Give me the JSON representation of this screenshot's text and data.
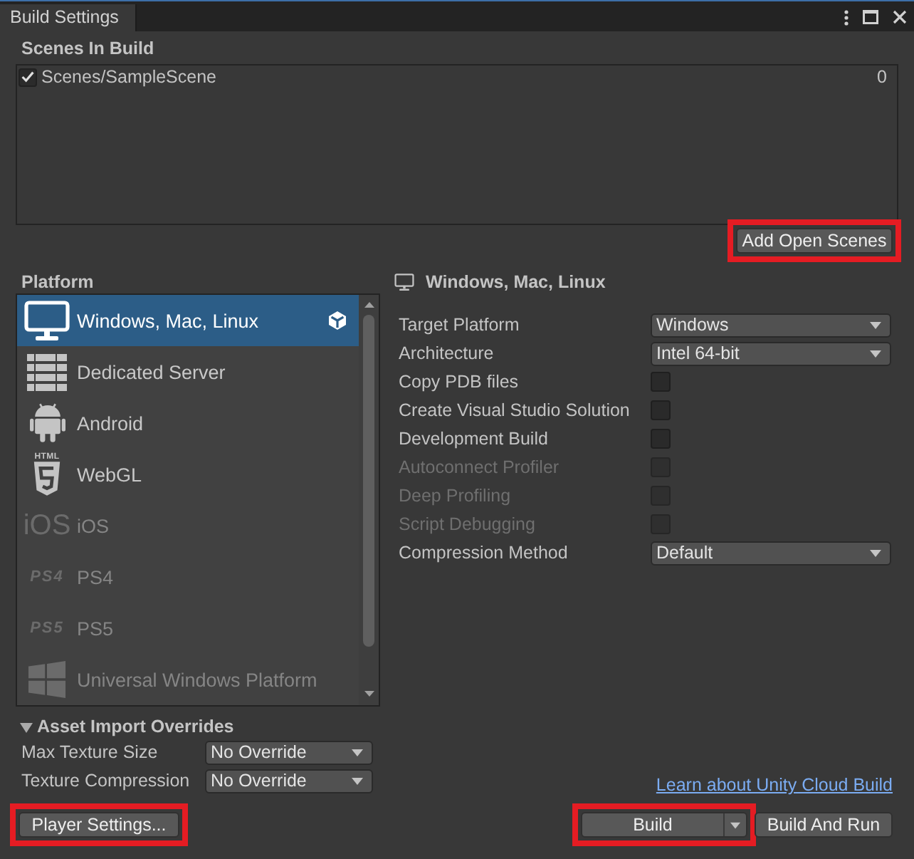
{
  "window": {
    "title": "Build Settings"
  },
  "scenes_in_build": {
    "title": "Scenes In Build",
    "scenes": [
      {
        "name": "Scenes/SampleScene",
        "checked": true,
        "index": "0"
      }
    ],
    "add_open_scenes_button": {
      "label": "Add Open Scenes",
      "highlighted": true
    }
  },
  "platform": {
    "title": "Platform",
    "items": [
      {
        "label": "Windows, Mac, Linux",
        "selected": true,
        "active": true,
        "disabled": false
      },
      {
        "label": "Dedicated Server",
        "selected": false,
        "active": false,
        "disabled": false
      },
      {
        "label": "Android",
        "selected": false,
        "active": false,
        "disabled": false
      },
      {
        "label": "WebGL",
        "logo_text": "HTML",
        "selected": false,
        "active": false,
        "disabled": false
      },
      {
        "label": "iOS",
        "logo_text": "iOS",
        "selected": false,
        "active": false,
        "disabled": true
      },
      {
        "label": "PS4",
        "logo_text": "PS4",
        "selected": false,
        "active": false,
        "disabled": true
      },
      {
        "label": "PS5",
        "logo_text": "PS5",
        "selected": false,
        "active": false,
        "disabled": true
      },
      {
        "label": "Universal Windows Platform",
        "selected": false,
        "active": false,
        "disabled": true
      }
    ]
  },
  "platform_settings": {
    "title": "Windows, Mac, Linux",
    "rows": [
      {
        "kind": "dropdown",
        "label": "Target Platform",
        "value": "Windows"
      },
      {
        "kind": "dropdown",
        "label": "Architecture",
        "value": "Intel 64-bit"
      },
      {
        "kind": "checkbox",
        "label": "Copy PDB files",
        "checked": false,
        "disabled": false
      },
      {
        "kind": "checkbox",
        "label": "Create Visual Studio Solution",
        "checked": false,
        "disabled": false
      },
      {
        "kind": "checkbox",
        "label": "Development Build",
        "checked": false,
        "disabled": false
      },
      {
        "kind": "checkbox",
        "label": "Autoconnect Profiler",
        "checked": false,
        "disabled": true
      },
      {
        "kind": "checkbox",
        "label": "Deep Profiling",
        "checked": false,
        "disabled": true
      },
      {
        "kind": "checkbox",
        "label": "Script Debugging",
        "checked": false,
        "disabled": true
      },
      {
        "kind": "dropdown",
        "label": "Compression Method",
        "value": "Default"
      }
    ]
  },
  "asset_import_overrides": {
    "title": "Asset Import Overrides",
    "expanded": true,
    "rows": [
      {
        "label": "Max Texture Size",
        "value": "No Override"
      },
      {
        "label": "Texture Compression",
        "value": "No Override"
      }
    ]
  },
  "cloud_build_link": "Learn about Unity Cloud Build",
  "player_settings_button": {
    "label": "Player Settings...",
    "highlighted": true
  },
  "build_buttons": [
    {
      "kind": "split",
      "label": "Build",
      "highlighted": true
    },
    {
      "kind": "plain",
      "label": "Build And Run",
      "highlighted": false
    }
  ]
}
